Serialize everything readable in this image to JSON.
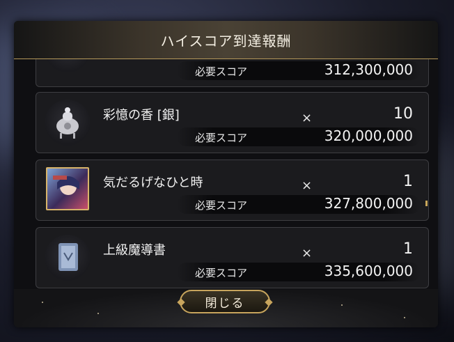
{
  "dialog": {
    "title": "ハイスコア到達報酬",
    "close_label": "閉じる"
  },
  "rewards": [
    {
      "name": "",
      "times": "",
      "qty": "",
      "score_label": "必要スコア",
      "score_value": "312,300,000",
      "icon": "book-item-icon"
    },
    {
      "name": "彩憶の香 [銀]",
      "times": "×",
      "qty": "10",
      "score_label": "必要スコア",
      "score_value": "320,000,000",
      "icon": "silver-incense-burner-icon"
    },
    {
      "name": "気だるげなひと時",
      "times": "×",
      "qty": "1",
      "score_label": "必要スコア",
      "score_value": "327,800,000",
      "icon": "character-card-icon"
    },
    {
      "name": "上級魔導書",
      "times": "×",
      "qty": "1",
      "score_label": "必要スコア",
      "score_value": "335,600,000",
      "icon": "advanced-grimoire-icon"
    }
  ],
  "colors": {
    "accent_gold": "#c8a55d",
    "card_bg": "#1b1b1e"
  }
}
